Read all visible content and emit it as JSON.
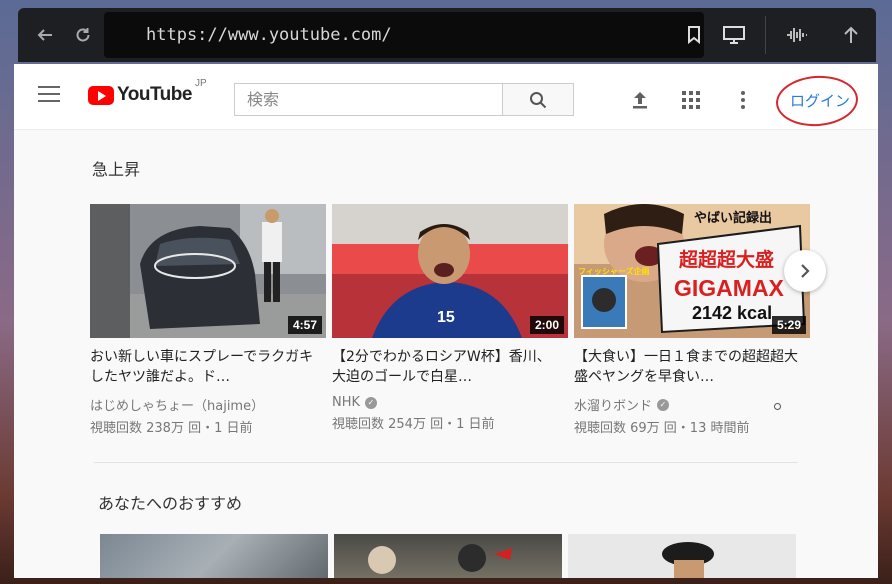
{
  "browser": {
    "url": "https://www.youtube.com/"
  },
  "masthead": {
    "logo_text": "YouTube",
    "region": "JP",
    "search_placeholder": "検索",
    "login_label": "ログイン"
  },
  "trending": {
    "title": "急上昇",
    "videos": [
      {
        "title": "おい新しい車にスプレーでラクガキしたヤツ誰だよ。ド…",
        "channel": "はじめしゃちょー（hajime）",
        "verified": false,
        "meta": "視聴回数 238万 回・1 日前",
        "duration": "4:57"
      },
      {
        "title": "【2分でわかるロシアW杯】香川、大迫のゴールで白星…",
        "channel": "NHK",
        "verified": true,
        "meta": "視聴回数 254万 回・1 日前",
        "duration": "2:00"
      },
      {
        "title": "【大食い】一日１食までの超超超大盛ペヤングを早食い…",
        "channel": "水溜りボンド",
        "verified": true,
        "meta": "視聴回数 69万 回・13 時間前",
        "duration": "5:29"
      }
    ]
  },
  "recommended": {
    "title": "あなたへのおすすめ"
  },
  "thumb3_text": {
    "line1": "やばい記録出",
    "line2": "超超超大盛",
    "line3": "GIGAMAX",
    "line4": "2142 kcal",
    "badge": "フィッシャーズ企画"
  },
  "colors": {
    "brand_red": "#ff0000",
    "link_blue": "#2a7ad6",
    "annotation_red": "#d6262e"
  }
}
